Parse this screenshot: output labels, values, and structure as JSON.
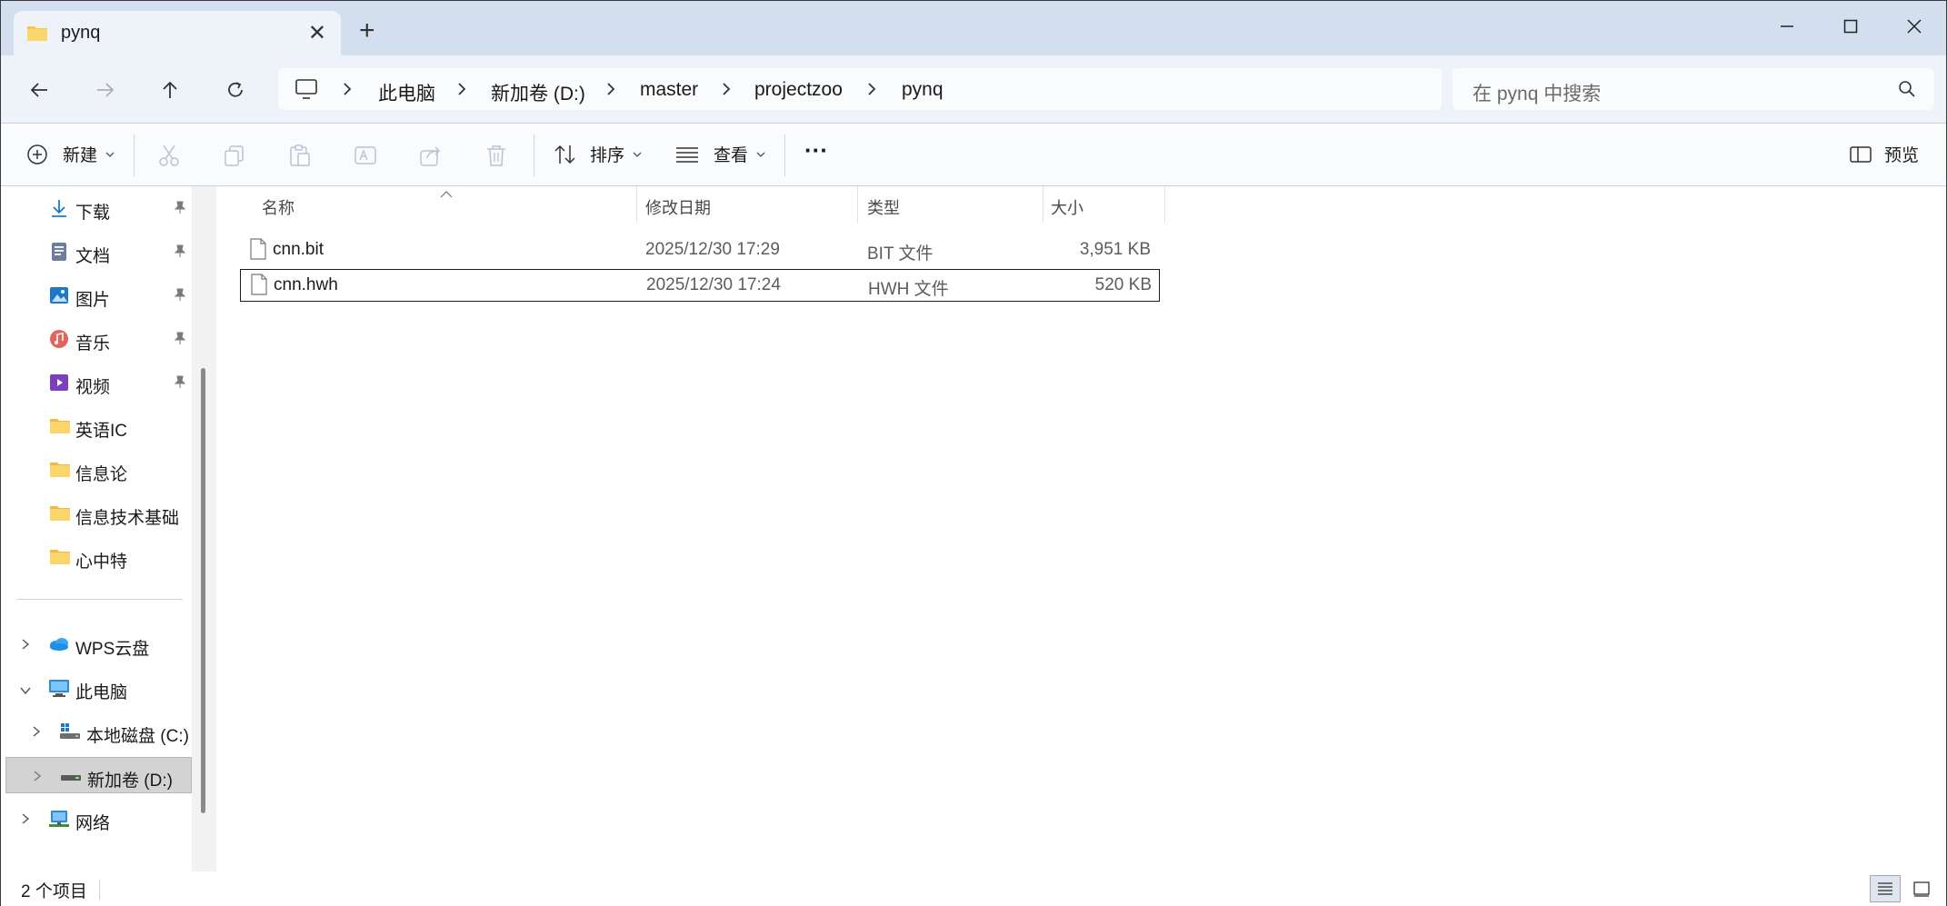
{
  "window": {
    "tab_title": "pynq",
    "new_tab": "+"
  },
  "nav": {
    "breadcrumbs": [
      "此电脑",
      "新加卷 (D:)",
      "master",
      "projectzoo",
      "pynq"
    ],
    "search_placeholder": "在 pynq 中搜索"
  },
  "commandbar": {
    "new_label": "新建",
    "sort_label": "排序",
    "view_label": "查看",
    "more_label": "···",
    "preview_label": "预览"
  },
  "sidebar": {
    "quick_access": [
      {
        "label": "下载",
        "icon": "download-icon",
        "pinned": true
      },
      {
        "label": "文档",
        "icon": "document-icon",
        "pinned": true
      },
      {
        "label": "图片",
        "icon": "pictures-icon",
        "pinned": true
      },
      {
        "label": "音乐",
        "icon": "music-icon",
        "pinned": true
      },
      {
        "label": "视频",
        "icon": "video-icon",
        "pinned": true
      },
      {
        "label": "英语IC",
        "icon": "folder-icon",
        "pinned": false
      },
      {
        "label": "信息论",
        "icon": "folder-icon",
        "pinned": false
      },
      {
        "label": "信息技术基础",
        "icon": "folder-icon",
        "pinned": false
      },
      {
        "label": "心中特",
        "icon": "folder-icon",
        "pinned": false
      }
    ],
    "locations": [
      {
        "label": "WPS云盘",
        "icon": "cloud-icon",
        "expanded": false
      },
      {
        "label": "此电脑",
        "icon": "computer-icon",
        "expanded": true
      },
      {
        "label": "本地磁盘 (C:)",
        "icon": "drive-c-icon",
        "expanded": false
      },
      {
        "label": "新加卷 (D:)",
        "icon": "drive-d-icon",
        "expanded": false,
        "selected": true
      },
      {
        "label": "网络",
        "icon": "network-icon",
        "expanded": false
      }
    ]
  },
  "files": {
    "columns": [
      "名称",
      "修改日期",
      "类型",
      "大小"
    ],
    "rows": [
      {
        "name": "cnn.bit",
        "modified": "2025/12/30 17:29",
        "type": "BIT 文件",
        "size": "3,951 KB"
      },
      {
        "name": "cnn.hwh",
        "modified": "2025/12/30 17:24",
        "type": "HWH 文件",
        "size": "520 KB"
      }
    ]
  },
  "status": {
    "item_count": "2 个项目"
  },
  "colors": {
    "titlebar": "#d3dfee",
    "navrow": "#eef3f9",
    "folder": "#f7c64a",
    "accent": "#0067c0"
  }
}
